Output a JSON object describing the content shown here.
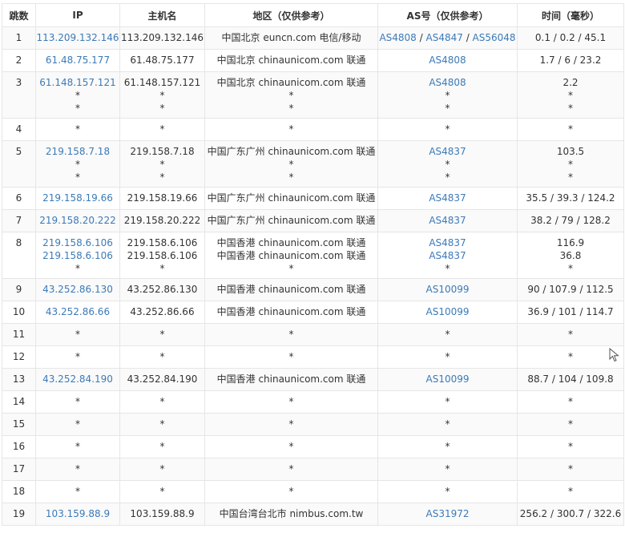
{
  "headers": {
    "hop": "跳数",
    "ip": "IP",
    "host": "主机名",
    "region": "地区（仅供参考）",
    "as": "AS号（仅供参考）",
    "time": "时间（毫秒）"
  },
  "rows": [
    {
      "hop": "1",
      "lines": [
        {
          "ip": "113.209.132.146",
          "host": "113.209.132.146",
          "region": "中国北京 euncn.com 电信/移动",
          "as": [
            "AS4808",
            "AS4847",
            "AS56048"
          ],
          "time": "0.1 / 0.2 / 45.1"
        }
      ]
    },
    {
      "hop": "2",
      "lines": [
        {
          "ip": "61.48.75.177",
          "host": "61.48.75.177",
          "region": "中国北京 chinaunicom.com 联通",
          "as": [
            "AS4808"
          ],
          "time": "1.7 / 6 / 23.2"
        }
      ]
    },
    {
      "hop": "3",
      "lines": [
        {
          "ip": "61.148.157.121",
          "host": "61.148.157.121",
          "region": "中国北京 chinaunicom.com 联通",
          "as": [
            "AS4808"
          ],
          "time": "2.2"
        },
        {
          "ip": "*",
          "host": "*",
          "region": "*",
          "as": [
            "*"
          ],
          "time": "*"
        },
        {
          "ip": "*",
          "host": "*",
          "region": "*",
          "as": [
            "*"
          ],
          "time": "*"
        }
      ]
    },
    {
      "hop": "4",
      "lines": [
        {
          "ip": "*",
          "host": "*",
          "region": "*",
          "as": [
            "*"
          ],
          "time": "*"
        }
      ]
    },
    {
      "hop": "5",
      "lines": [
        {
          "ip": "219.158.7.18",
          "host": "219.158.7.18",
          "region": "中国广东广州 chinaunicom.com 联通",
          "as": [
            "AS4837"
          ],
          "time": "103.5"
        },
        {
          "ip": "*",
          "host": "*",
          "region": "*",
          "as": [
            "*"
          ],
          "time": "*"
        },
        {
          "ip": "*",
          "host": "*",
          "region": "*",
          "as": [
            "*"
          ],
          "time": "*"
        }
      ]
    },
    {
      "hop": "6",
      "lines": [
        {
          "ip": "219.158.19.66",
          "host": "219.158.19.66",
          "region": "中国广东广州 chinaunicom.com 联通",
          "as": [
            "AS4837"
          ],
          "time": "35.5 / 39.3 / 124.2"
        }
      ]
    },
    {
      "hop": "7",
      "lines": [
        {
          "ip": "219.158.20.222",
          "host": "219.158.20.222",
          "region": "中国广东广州 chinaunicom.com 联通",
          "as": [
            "AS4837"
          ],
          "time": "38.2 / 79 / 128.2"
        }
      ]
    },
    {
      "hop": "8",
      "lines": [
        {
          "ip": "219.158.6.106",
          "host": "219.158.6.106",
          "region": "中国香港 chinaunicom.com 联通",
          "as": [
            "AS4837"
          ],
          "time": "116.9"
        },
        {
          "ip": "219.158.6.106",
          "host": "219.158.6.106",
          "region": "中国香港 chinaunicom.com 联通",
          "as": [
            "AS4837"
          ],
          "time": "36.8"
        },
        {
          "ip": "*",
          "host": "*",
          "region": "*",
          "as": [
            "*"
          ],
          "time": "*"
        }
      ]
    },
    {
      "hop": "9",
      "lines": [
        {
          "ip": "43.252.86.130",
          "host": "43.252.86.130",
          "region": "中国香港 chinaunicom.com 联通",
          "as": [
            "AS10099"
          ],
          "time": "90 / 107.9 / 112.5"
        }
      ]
    },
    {
      "hop": "10",
      "lines": [
        {
          "ip": "43.252.86.66",
          "host": "43.252.86.66",
          "region": "中国香港 chinaunicom.com 联通",
          "as": [
            "AS10099"
          ],
          "time": "36.9 / 101 / 114.7"
        }
      ]
    },
    {
      "hop": "11",
      "lines": [
        {
          "ip": "*",
          "host": "*",
          "region": "*",
          "as": [
            "*"
          ],
          "time": "*"
        }
      ]
    },
    {
      "hop": "12",
      "lines": [
        {
          "ip": "*",
          "host": "*",
          "region": "*",
          "as": [
            "*"
          ],
          "time": "*"
        }
      ]
    },
    {
      "hop": "13",
      "lines": [
        {
          "ip": "43.252.84.190",
          "host": "43.252.84.190",
          "region": "中国香港 chinaunicom.com 联通",
          "as": [
            "AS10099"
          ],
          "time": "88.7 / 104 / 109.8"
        }
      ]
    },
    {
      "hop": "14",
      "lines": [
        {
          "ip": "*",
          "host": "*",
          "region": "*",
          "as": [
            "*"
          ],
          "time": "*"
        }
      ]
    },
    {
      "hop": "15",
      "lines": [
        {
          "ip": "*",
          "host": "*",
          "region": "*",
          "as": [
            "*"
          ],
          "time": "*"
        }
      ]
    },
    {
      "hop": "16",
      "lines": [
        {
          "ip": "*",
          "host": "*",
          "region": "*",
          "as": [
            "*"
          ],
          "time": "*"
        }
      ]
    },
    {
      "hop": "17",
      "lines": [
        {
          "ip": "*",
          "host": "*",
          "region": "*",
          "as": [
            "*"
          ],
          "time": "*"
        }
      ]
    },
    {
      "hop": "18",
      "lines": [
        {
          "ip": "*",
          "host": "*",
          "region": "*",
          "as": [
            "*"
          ],
          "time": "*"
        }
      ]
    },
    {
      "hop": "19",
      "lines": [
        {
          "ip": "103.159.88.9",
          "host": "103.159.88.9",
          "region": "中国台湾台北市 nimbus.com.tw",
          "as": [
            "AS31972"
          ],
          "time": "256.2 / 300.7 / 322.6"
        }
      ]
    }
  ],
  "colors": {
    "link": "#3c7ab8",
    "text": "#333333",
    "border": "#e6e6e6",
    "stripe": "#fafafa"
  },
  "cursor_icon": "mouse-pointer-icon"
}
